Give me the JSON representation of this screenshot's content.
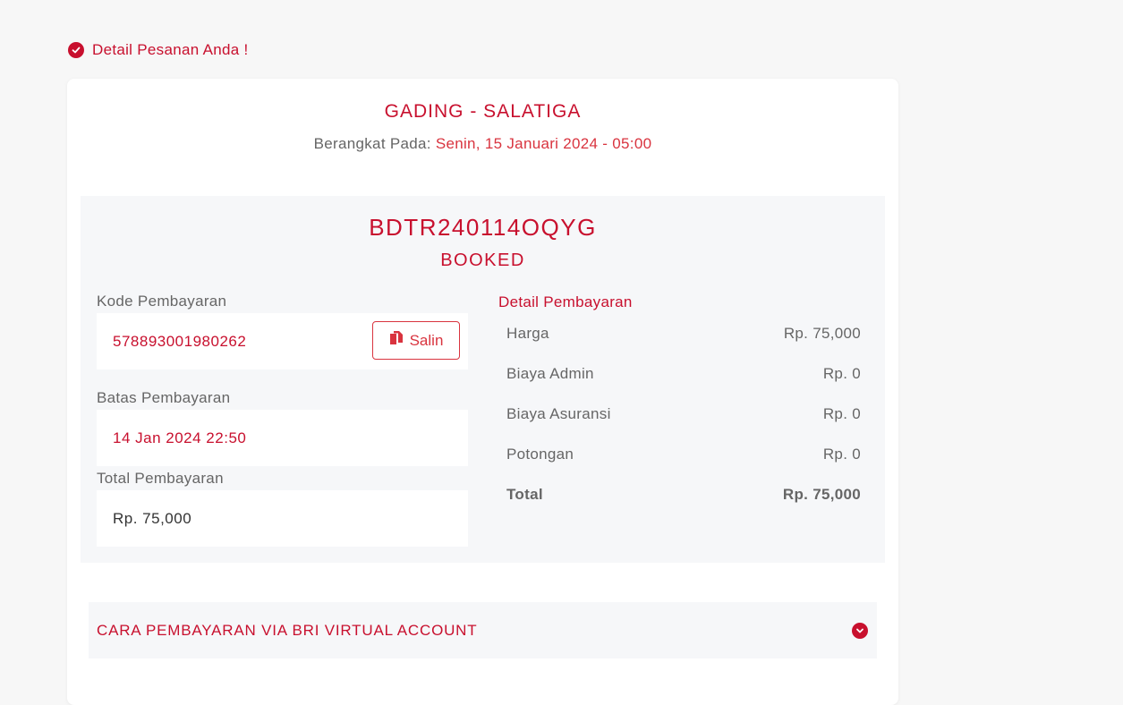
{
  "header": {
    "title": "Detail Pesanan Anda !"
  },
  "trip": {
    "route": "GADING - SALATIGA",
    "depart_label": "Berangkat Pada:",
    "depart_datetime": "Senin, 15 Januari 2024 - 05:00"
  },
  "booking": {
    "code": "BDTR240114OQYG",
    "status": "BOOKED"
  },
  "payment": {
    "code_label": "Kode Pembayaran",
    "code_value": "578893001980262",
    "copy_label": "Salin",
    "deadline_label": "Batas Pembayaran",
    "deadline_value": "14 Jan 2024 22:50",
    "total_label": "Total Pembayaran",
    "total_value": "Rp. 75,000"
  },
  "details": {
    "title": "Detail Pembayaran",
    "rows": [
      {
        "label": "Harga",
        "value": "Rp. 75,000"
      },
      {
        "label": "Biaya Admin",
        "value": "Rp. 0"
      },
      {
        "label": "Biaya Asuransi",
        "value": "Rp. 0"
      },
      {
        "label": "Potongan",
        "value": "Rp. 0"
      },
      {
        "label": "Total",
        "value": "Rp. 75,000"
      }
    ]
  },
  "instructions": {
    "title": "CARA PEMBAYARAN VIA BRI VIRTUAL ACCOUNT"
  },
  "icons": {
    "heading": "check-circle-icon",
    "copy": "copy-icon",
    "accordion": "chevron-down-circle-icon"
  },
  "colors": {
    "accent": "#c8102e",
    "panel": "#f6f7f9",
    "background": "#f7f7f7"
  }
}
